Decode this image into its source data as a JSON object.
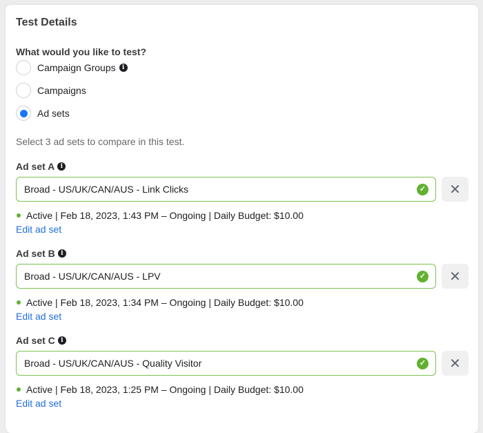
{
  "section": {
    "title": "Test Details",
    "question": "What would you like to test?",
    "options": [
      {
        "label": "Campaign Groups",
        "has_info": true,
        "selected": false
      },
      {
        "label": "Campaigns",
        "has_info": false,
        "selected": false
      },
      {
        "label": "Ad sets",
        "has_info": false,
        "selected": true
      }
    ],
    "helper_text": "Select 3 ad sets to compare in this test."
  },
  "icons": {
    "info": "i",
    "check": "✓",
    "close": "✕"
  },
  "colors": {
    "accent": "#1877f2",
    "valid_border": "#7bc14f",
    "success": "#63b031",
    "link": "#216fdb"
  },
  "adsets": [
    {
      "label": "Ad set A",
      "value": "Broad - US/UK/CAN/AUS - Link Clicks",
      "status": "Active | Feb 18, 2023, 1:43 PM – Ongoing | Daily Budget: $10.00",
      "edit_label": "Edit ad set"
    },
    {
      "label": "Ad set B",
      "value": "Broad - US/UK/CAN/AUS - LPV",
      "status": "Active | Feb 18, 2023, 1:34 PM – Ongoing | Daily Budget: $10.00",
      "edit_label": "Edit ad set"
    },
    {
      "label": "Ad set C",
      "value": "Broad - US/UK/CAN/AUS - Quality Visitor",
      "status": "Active | Feb 18, 2023, 1:25 PM – Ongoing | Daily Budget: $10.00",
      "edit_label": "Edit ad set"
    }
  ]
}
